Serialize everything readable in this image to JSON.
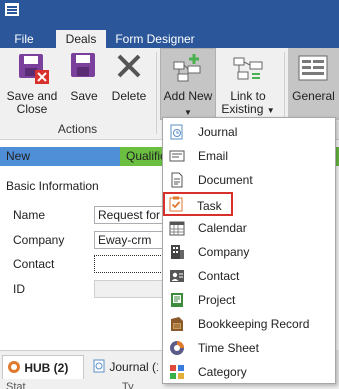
{
  "ribbon": {
    "tabs": [
      {
        "label": "File"
      },
      {
        "label": "Deals"
      },
      {
        "label": "Form Designer"
      }
    ],
    "buttons": {
      "save_and_close": "Save and\nClose",
      "save": "Save",
      "delete": "Delete",
      "add_new": "Add New",
      "link_to_existing_line1": "Link to",
      "link_to_existing_line2": "Existing",
      "general": "General"
    },
    "group_actions": "Actions"
  },
  "stages": [
    {
      "label": "New",
      "color": "#4f8fd8"
    },
    {
      "label": "Qualification",
      "color": "#6abf40"
    }
  ],
  "form": {
    "section_title": "Basic Information",
    "fields": [
      {
        "label": "Name",
        "value": "Request for p"
      },
      {
        "label": "Company",
        "value": "Eway-crm"
      },
      {
        "label": "Contact",
        "value": ""
      },
      {
        "label": "ID",
        "value": ""
      }
    ]
  },
  "bottom_tabs": [
    {
      "label": "HUB (2)"
    },
    {
      "label": "Journal (1"
    }
  ],
  "bottom_subrow": [
    "Stat",
    "Ty"
  ],
  "add_new_menu": {
    "items": [
      {
        "label": "Journal",
        "icon": "journal-icon"
      },
      {
        "label": "Email",
        "icon": "email-icon"
      },
      {
        "label": "Document",
        "icon": "document-icon"
      },
      {
        "label": "Task",
        "icon": "task-icon",
        "selected": true
      },
      {
        "label": "Calendar",
        "icon": "calendar-icon"
      },
      {
        "label": "Company",
        "icon": "company-icon"
      },
      {
        "label": "Contact",
        "icon": "contact-icon"
      },
      {
        "label": "Project",
        "icon": "project-icon"
      },
      {
        "label": "Bookkeeping Record",
        "icon": "bookkeeping-icon"
      },
      {
        "label": "Time Sheet",
        "icon": "timesheet-icon"
      },
      {
        "label": "Category",
        "icon": "category-icon"
      }
    ]
  },
  "colors": {
    "title_bar": "#2b579a",
    "selection_outline": "#d9302b"
  }
}
